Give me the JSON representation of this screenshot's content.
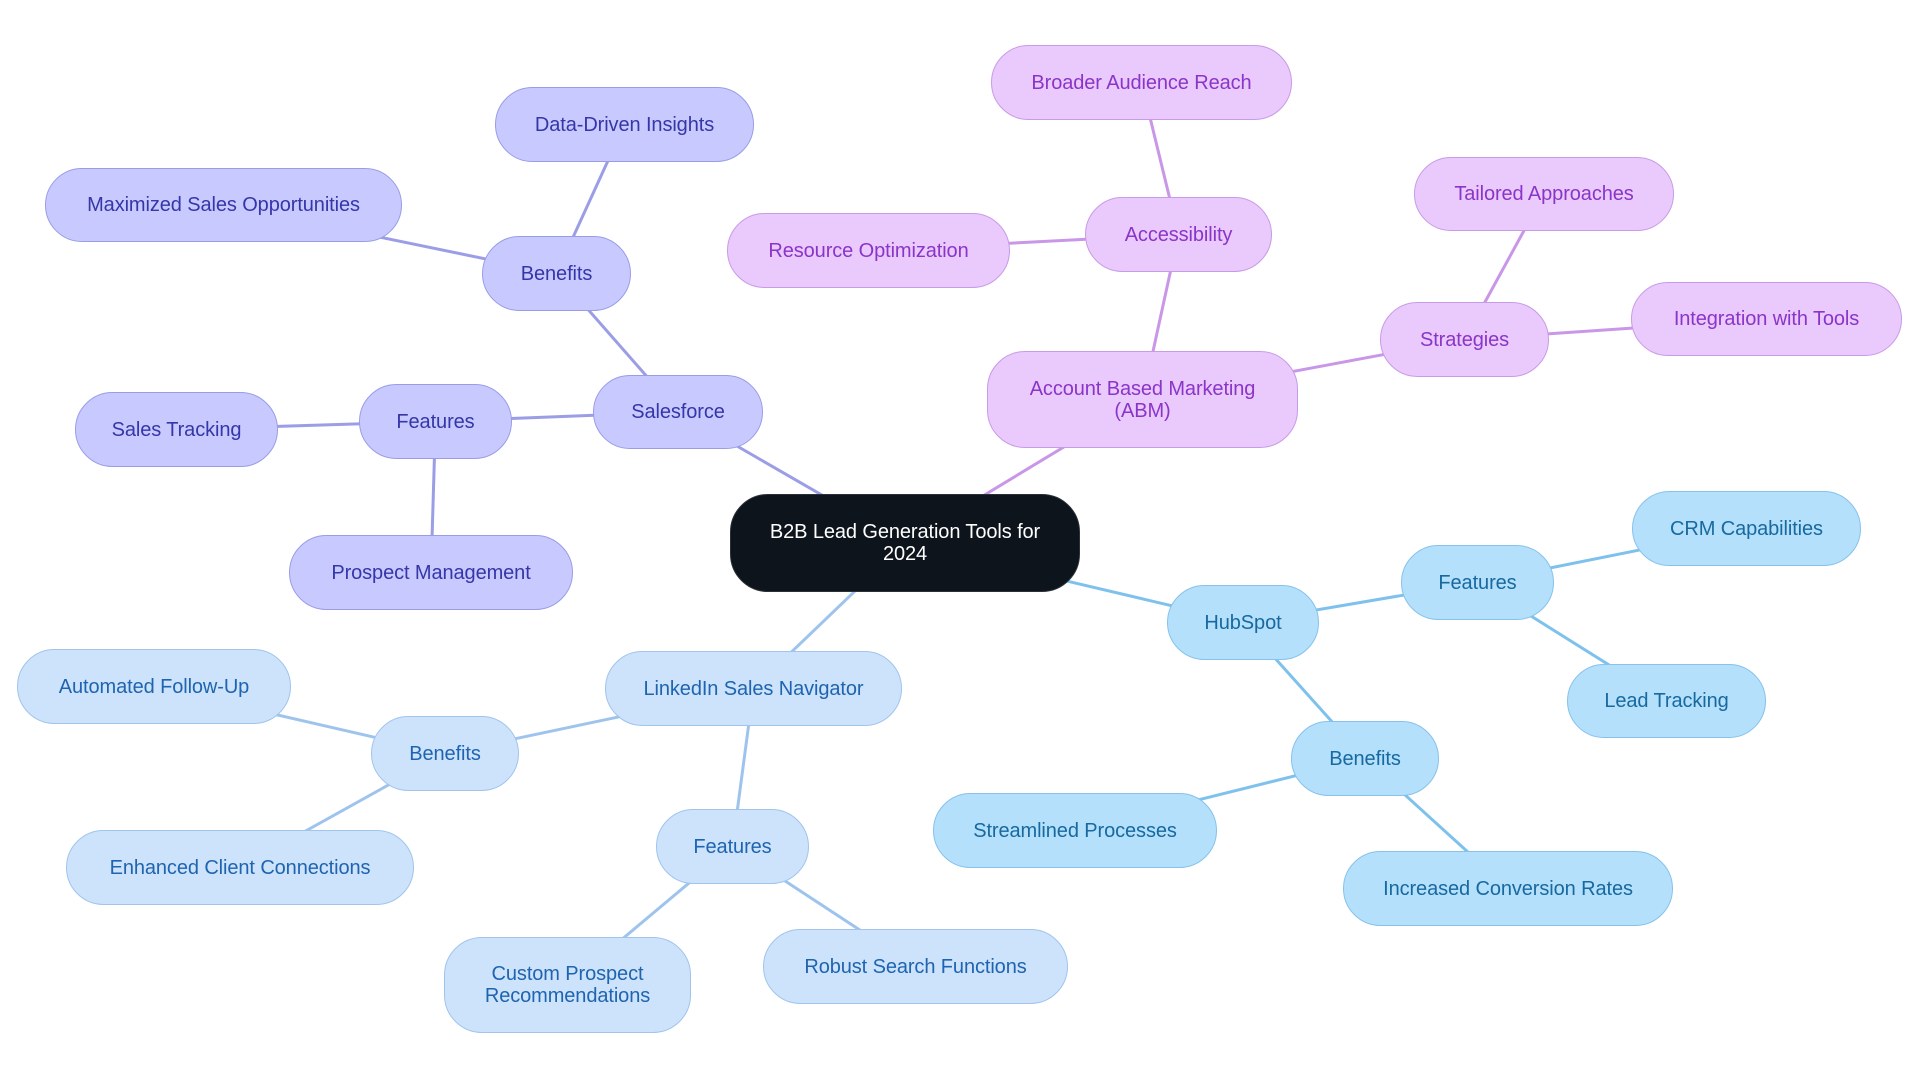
{
  "diagram": {
    "type": "mindmap",
    "root": {
      "id": "root",
      "label": "B2B Lead Generation Tools for\n2024"
    },
    "branch_colors": {
      "salesforce": {
        "fill": "#c8caff",
        "stroke": "#9a9ce6",
        "text": "#3536a8",
        "edge": "#9b9de6"
      },
      "abm": {
        "fill": "#eac9fd",
        "stroke": "#c89be6",
        "text": "#8a35c8",
        "edge": "#c996e8"
      },
      "hubspot": {
        "fill": "#b4e0fc",
        "stroke": "#86c2ea",
        "text": "#17699f",
        "edge": "#7ec1ec"
      },
      "linkedin": {
        "fill": "#cde3fb",
        "stroke": "#a0c4ec",
        "text": "#1e64b0",
        "edge": "#9ec4ee"
      },
      "root": {
        "fill": "#0d141c",
        "text": "#ffffff"
      }
    },
    "nodes": [
      {
        "id": "root",
        "label": "B2B Lead Generation Tools for\n2024",
        "branch": "root"
      },
      {
        "id": "salesforce",
        "label": "Salesforce",
        "branch": "salesforce",
        "parent": "root"
      },
      {
        "id": "sf-benefits",
        "label": "Benefits",
        "branch": "salesforce",
        "parent": "salesforce"
      },
      {
        "id": "sf-data-driven",
        "label": "Data-Driven Insights",
        "branch": "salesforce",
        "parent": "sf-benefits"
      },
      {
        "id": "sf-maximized",
        "label": "Maximized Sales Opportunities",
        "branch": "salesforce",
        "parent": "sf-benefits"
      },
      {
        "id": "sf-features",
        "label": "Features",
        "branch": "salesforce",
        "parent": "salesforce"
      },
      {
        "id": "sf-sales-tracking",
        "label": "Sales Tracking",
        "branch": "salesforce",
        "parent": "sf-features"
      },
      {
        "id": "sf-prospect-mgmt",
        "label": "Prospect Management",
        "branch": "salesforce",
        "parent": "sf-features"
      },
      {
        "id": "abm",
        "label": "Account Based Marketing\n(ABM)",
        "branch": "abm",
        "parent": "root"
      },
      {
        "id": "abm-accessibility",
        "label": "Accessibility",
        "branch": "abm",
        "parent": "abm"
      },
      {
        "id": "abm-broader",
        "label": "Broader Audience Reach",
        "branch": "abm",
        "parent": "abm-accessibility"
      },
      {
        "id": "abm-resource",
        "label": "Resource Optimization",
        "branch": "abm",
        "parent": "abm-accessibility"
      },
      {
        "id": "abm-strategies",
        "label": "Strategies",
        "branch": "abm",
        "parent": "abm"
      },
      {
        "id": "abm-tailored",
        "label": "Tailored Approaches",
        "branch": "abm",
        "parent": "abm-strategies"
      },
      {
        "id": "abm-integration",
        "label": "Integration with Tools",
        "branch": "abm",
        "parent": "abm-strategies"
      },
      {
        "id": "hubspot",
        "label": "HubSpot",
        "branch": "hubspot",
        "parent": "root"
      },
      {
        "id": "hs-features",
        "label": "Features",
        "branch": "hubspot",
        "parent": "hubspot"
      },
      {
        "id": "hs-crm",
        "label": "CRM Capabilities",
        "branch": "hubspot",
        "parent": "hs-features"
      },
      {
        "id": "hs-lead-tracking",
        "label": "Lead Tracking",
        "branch": "hubspot",
        "parent": "hs-features"
      },
      {
        "id": "hs-benefits",
        "label": "Benefits",
        "branch": "hubspot",
        "parent": "hubspot"
      },
      {
        "id": "hs-streamlined",
        "label": "Streamlined Processes",
        "branch": "hubspot",
        "parent": "hs-benefits"
      },
      {
        "id": "hs-conversion",
        "label": "Increased Conversion Rates",
        "branch": "hubspot",
        "parent": "hs-benefits"
      },
      {
        "id": "linkedin",
        "label": "LinkedIn Sales Navigator",
        "branch": "linkedin",
        "parent": "root"
      },
      {
        "id": "li-benefits",
        "label": "Benefits",
        "branch": "linkedin",
        "parent": "linkedin"
      },
      {
        "id": "li-followup",
        "label": "Automated Follow-Up",
        "branch": "linkedin",
        "parent": "li-benefits"
      },
      {
        "id": "li-client",
        "label": "Enhanced Client Connections",
        "branch": "linkedin",
        "parent": "li-benefits"
      },
      {
        "id": "li-features",
        "label": "Features",
        "branch": "linkedin",
        "parent": "linkedin"
      },
      {
        "id": "li-custom",
        "label": "Custom Prospect\nRecommendations",
        "branch": "linkedin",
        "parent": "li-features"
      },
      {
        "id": "li-search",
        "label": "Robust Search Functions",
        "branch": "linkedin",
        "parent": "li-features"
      }
    ]
  }
}
